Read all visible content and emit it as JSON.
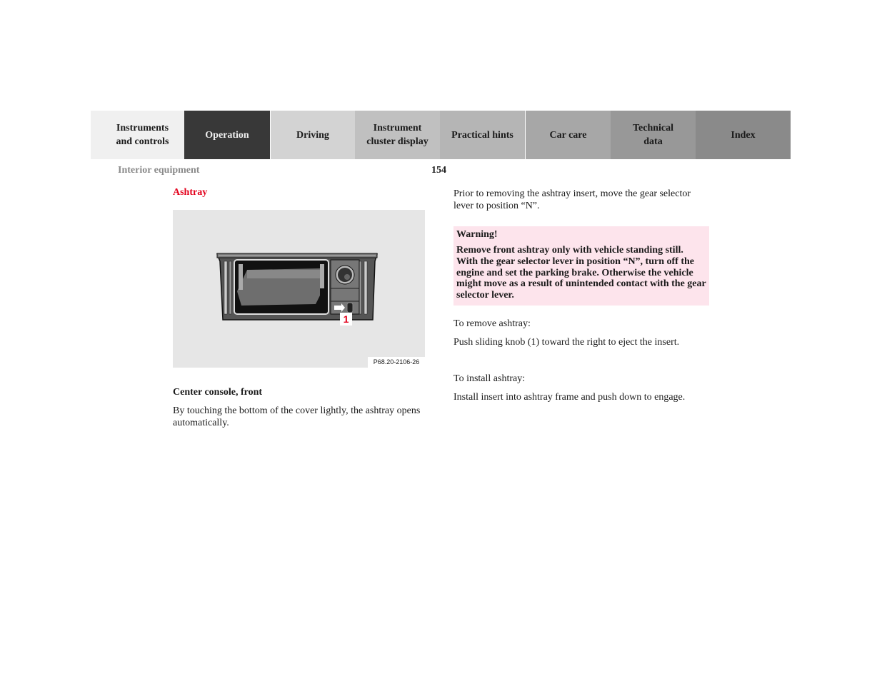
{
  "nav": {
    "tabs": [
      {
        "line1": "Instruments",
        "line2": "and controls",
        "active": false
      },
      {
        "line1": "Operation",
        "line2": "",
        "active": true
      },
      {
        "line1": "Driving",
        "line2": "",
        "active": false
      },
      {
        "line1": "Instrument",
        "line2": "cluster display",
        "active": false
      },
      {
        "line1": "Practical hints",
        "line2": "",
        "active": false
      },
      {
        "line1": "Car care",
        "line2": "",
        "active": false
      },
      {
        "line1": "Technical",
        "line2": "data",
        "active": false
      },
      {
        "line1": "Index",
        "line2": "",
        "active": false
      }
    ]
  },
  "header": {
    "section": "Interior equipment",
    "page_number": "154"
  },
  "left": {
    "title": "Ashtray",
    "figure": {
      "callout": "1",
      "code": "P68.20-2106-26"
    },
    "caption": "Center console, front",
    "body": "By touching the bottom of the cover lightly, the ashtray opens automatically."
  },
  "right": {
    "intro": "Prior to removing the ashtray insert, move the gear selector lever to position “N”.",
    "warning": {
      "title": "Warning!",
      "text": "Remove front ashtray only with vehicle standing still. With the gear selector lever in position “N”, turn off the engine and set the parking brake. Otherwise the vehicle might move as a result of unintended contact with the gear selector lever."
    },
    "remove_heading": "To remove ashtray:",
    "remove_text": "Push sliding knob (1) toward the right to eject the insert.",
    "install_heading": "To install ashtray:",
    "install_text": "Install insert into ashtray frame and push down to engage."
  },
  "colors": {
    "accent_red": "#e3001b",
    "warning_bg": "#fde4ec",
    "active_tab": "#383838"
  }
}
